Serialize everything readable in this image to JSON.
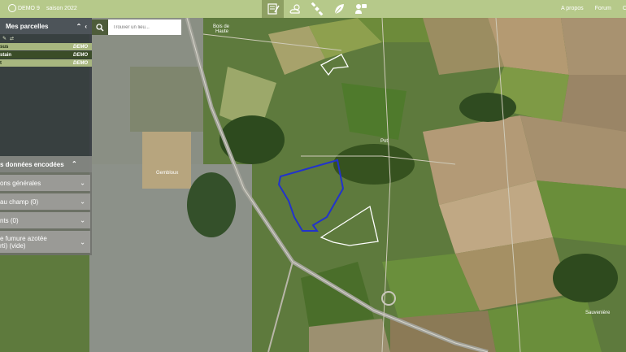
{
  "topbar": {
    "user": "DEMO 9",
    "season": "saison 2022",
    "nav_icons": [
      "notebook-icon",
      "weather-icon",
      "satellite-icon",
      "leaf-icon",
      "advisor-icon"
    ],
    "links": [
      "A propos",
      "Forum",
      "Co"
    ]
  },
  "search": {
    "placeholder": "Trouver un lieu..."
  },
  "panel": {
    "title": "Mes parcelles",
    "tools": [
      "✎",
      "⇄"
    ],
    "parcels": [
      {
        "name": "sus",
        "badge": "DEMO"
      },
      {
        "name": "stain",
        "badge": "DEMO"
      },
      {
        "name": "t",
        "badge": "DEMO"
      }
    ]
  },
  "data_panel": {
    "title": "s données encodées",
    "items": [
      {
        "label": "ons générales"
      },
      {
        "label": "au champ (0)"
      },
      {
        "label": "nts (0)"
      },
      {
        "label": "e fumure azotée",
        "label2": "rti) (vide)"
      }
    ]
  },
  "map": {
    "labels": [
      "Bois de",
      "Haute",
      "Gembloux",
      "Pot",
      "Sauvenière"
    ],
    "parcel_outline_colors": [
      "#ffffff",
      "#2233cc",
      "#ffffff"
    ]
  },
  "colors": {
    "topbar": "#b6c98a",
    "accent": "#8ea063",
    "panel": "#343a40"
  }
}
